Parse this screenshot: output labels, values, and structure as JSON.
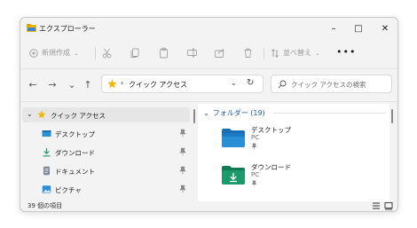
{
  "window": {
    "title": "エクスプローラー",
    "controls": {
      "minimize": "–",
      "maximize": "□",
      "close": "✕"
    }
  },
  "commandbar": {
    "new_label": "新規作成",
    "sort_label": "並べ替え",
    "more_label": "•••",
    "icons": [
      "cut-icon",
      "copy-icon",
      "paste-icon",
      "rename-icon",
      "share-icon",
      "delete-icon"
    ]
  },
  "nav": {
    "back": "←",
    "forward": "→",
    "recent": "⌄",
    "up": "↑"
  },
  "address": {
    "separator": "›",
    "path": "クイック アクセス",
    "dropdown": "⌄",
    "refresh": "↻"
  },
  "search": {
    "placeholder": "クイック アクセスの検索"
  },
  "navpane": {
    "quick_access_label": "クイック アクセス",
    "items": [
      {
        "label": "デスクトップ",
        "icon": "desktop-icon"
      },
      {
        "label": "ダウンロード",
        "icon": "download-icon"
      },
      {
        "label": "ドキュメント",
        "icon": "document-icon"
      },
      {
        "label": "ピクチャ",
        "icon": "picture-icon"
      }
    ]
  },
  "content": {
    "group_header": "フォルダー (19)",
    "folders": [
      {
        "name": "デスクトップ",
        "location": "PC",
        "icon": "desktop-folder-icon"
      },
      {
        "name": "ダウンロード",
        "location": "PC",
        "icon": "download-folder-icon"
      }
    ]
  },
  "status": {
    "item_count": "39 個の項目"
  },
  "colors": {
    "accent": "#1e5aa8",
    "star": "#f2b705",
    "folder_blue": "#2b8fd6",
    "folder_green": "#1c9a6b"
  }
}
